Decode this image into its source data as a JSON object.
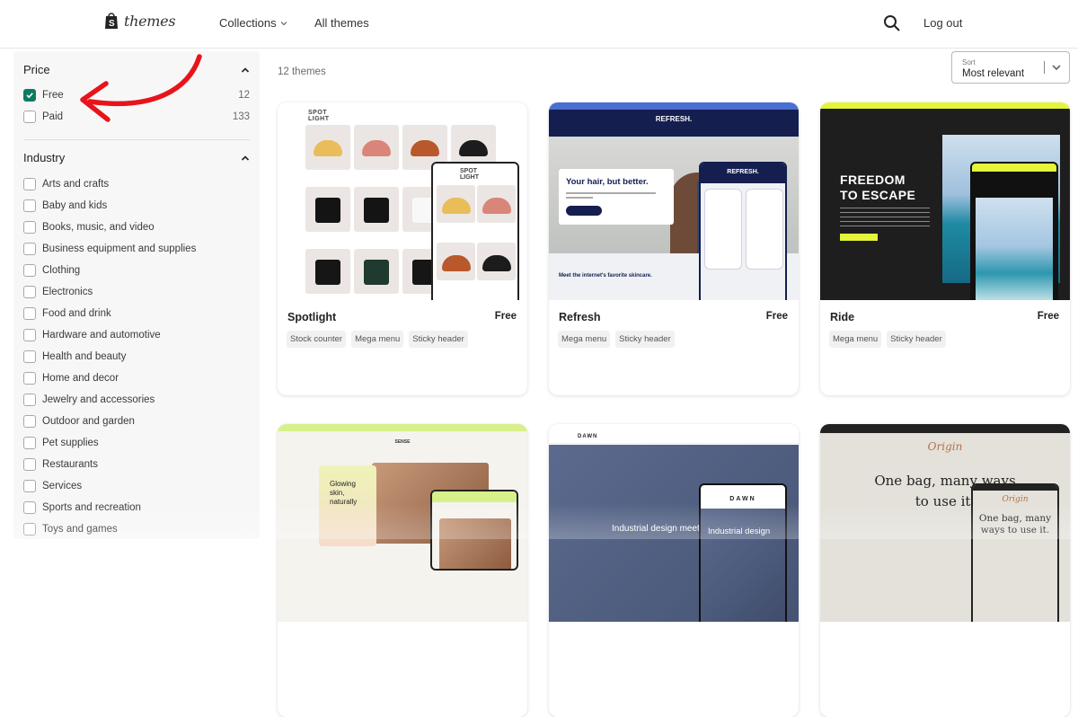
{
  "header": {
    "logo_text": "themes",
    "nav": {
      "collections": "Collections",
      "all_themes": "All themes"
    },
    "logout": "Log out"
  },
  "filters": {
    "price": {
      "title": "Price",
      "options": [
        {
          "label": "Free",
          "count": "12",
          "checked": true
        },
        {
          "label": "Paid",
          "count": "133",
          "checked": false
        }
      ]
    },
    "industry": {
      "title": "Industry",
      "options": [
        "Arts and crafts",
        "Baby and kids",
        "Books, music, and video",
        "Business equipment and supplies",
        "Clothing",
        "Electronics",
        "Food and drink",
        "Hardware and automotive",
        "Health and beauty",
        "Home and decor",
        "Jewelry and accessories",
        "Outdoor and garden",
        "Pet supplies",
        "Restaurants",
        "Services",
        "Sports and recreation",
        "Toys and games"
      ]
    }
  },
  "results": {
    "count_label": "12 themes",
    "sort": {
      "label": "Sort",
      "value": "Most relevant"
    }
  },
  "themes": [
    {
      "name": "Spotlight",
      "price": "Free",
      "tags": [
        "Stock counter",
        "Mega menu",
        "Sticky header"
      ],
      "preview": {
        "brand": "SPOT LIGHT"
      }
    },
    {
      "name": "Refresh",
      "price": "Free",
      "tags": [
        "Mega menu",
        "Sticky header"
      ],
      "preview": {
        "brand": "REFRESH.",
        "headline": "Your hair, but better.",
        "section": "Meet the internet's favorite skincare."
      }
    },
    {
      "name": "Ride",
      "price": "Free",
      "tags": [
        "Mega menu",
        "Sticky header"
      ],
      "preview": {
        "headline": "FREEDOM TO ESCAPE"
      }
    },
    {
      "preview": {
        "brand": "SENSE",
        "headline": "Glowing skin, naturally"
      }
    },
    {
      "preview": {
        "brand": "DAWN",
        "headline": "Industrial design meets",
        "phone_headline": "Industrial design"
      }
    },
    {
      "preview": {
        "brand": "Origin",
        "headline": "One bag, many ways to use it.",
        "phone_headline": "One bag, many ways to use it."
      }
    }
  ],
  "colors": {
    "checkbox_checked": "#0e7a5f",
    "annotation_arrow": "#e8141b"
  }
}
